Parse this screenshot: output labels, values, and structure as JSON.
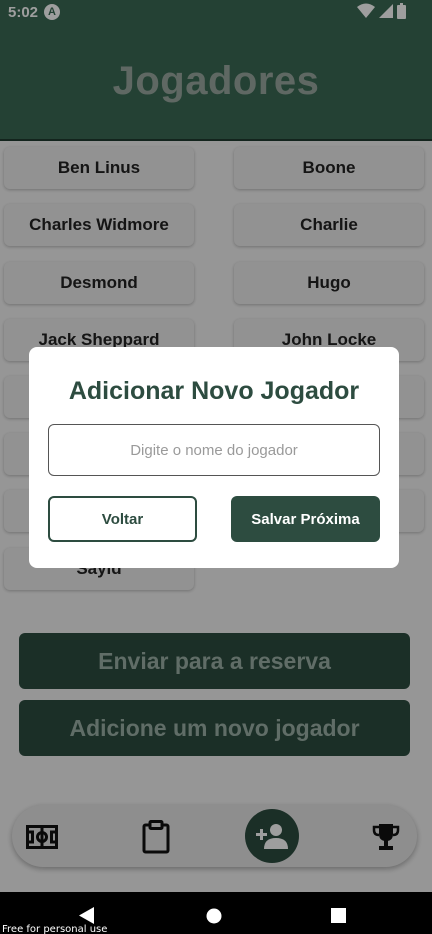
{
  "status_bar": {
    "time": "5:02",
    "indicator": "A"
  },
  "header": {
    "title": "Jogadores"
  },
  "players": [
    "Ben Linus",
    "Boone",
    "Charles Widmore",
    "Charlie",
    "Desmond",
    "Hugo",
    "Jack Sheppard",
    "John Locke",
    "",
    "",
    "",
    "",
    "",
    "",
    "Sayid"
  ],
  "actions": {
    "send_reserve": "Enviar para a reserva",
    "add_player": "Adicione um novo jogador"
  },
  "nav": {
    "items": [
      "field-icon",
      "clipboard-icon",
      "add-person-icon",
      "trophy-icon"
    ],
    "active": "add-person-icon"
  },
  "modal": {
    "title": "Adicionar Novo Jogador",
    "input_placeholder": "Digite o nome do jogador",
    "input_value": "",
    "back_label": "Voltar",
    "save_label": "Salvar Próxima"
  },
  "watermark": "Free for personal use",
  "colors": {
    "primary": "#2d4c40",
    "header": "#3a6a54",
    "surface": "#ececec"
  }
}
